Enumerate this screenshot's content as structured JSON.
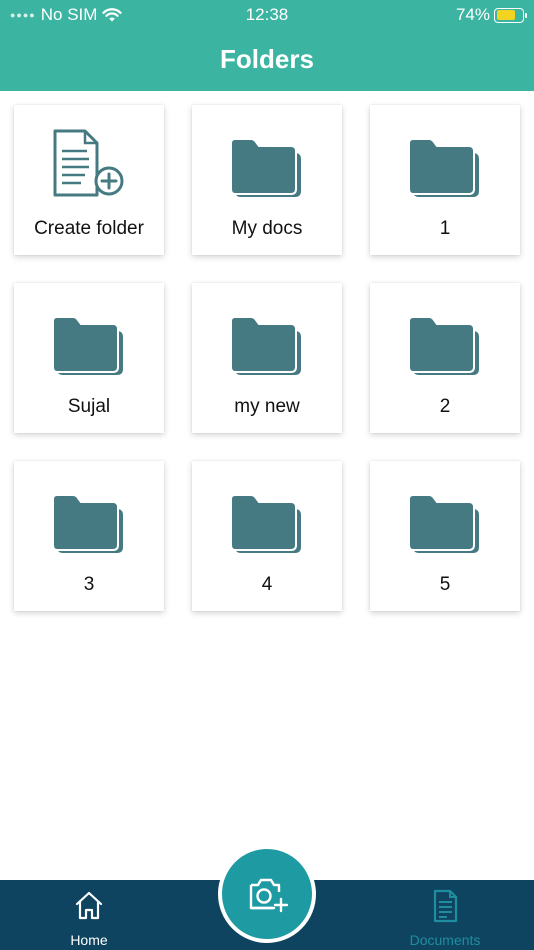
{
  "status_bar": {
    "carrier": "No SIM",
    "time": "12:38",
    "battery_percent": "74%",
    "battery_level": 0.74,
    "battery_color": "#f3d321"
  },
  "header": {
    "title": "Folders",
    "background_color": "#3bb5a1"
  },
  "folders": [
    {
      "label": "Create folder",
      "icon": "create-folder-icon"
    },
    {
      "label": "My docs",
      "icon": "folder-icon"
    },
    {
      "label": "1",
      "icon": "folder-icon"
    },
    {
      "label": "Sujal",
      "icon": "folder-icon"
    },
    {
      "label": "my new",
      "icon": "folder-icon"
    },
    {
      "label": "2",
      "icon": "folder-icon"
    },
    {
      "label": "3",
      "icon": "folder-icon"
    },
    {
      "label": "4",
      "icon": "folder-icon"
    },
    {
      "label": "5",
      "icon": "folder-icon"
    }
  ],
  "folder_icon_color": "#457a82",
  "bottom_nav": {
    "background_color": "#0e4460",
    "home_label": "Home",
    "home_icon": "home-icon",
    "documents_label": "Documents",
    "documents_icon": "document-icon",
    "camera_icon": "camera-add-icon",
    "camera_button_color": "#1e9aa3"
  }
}
